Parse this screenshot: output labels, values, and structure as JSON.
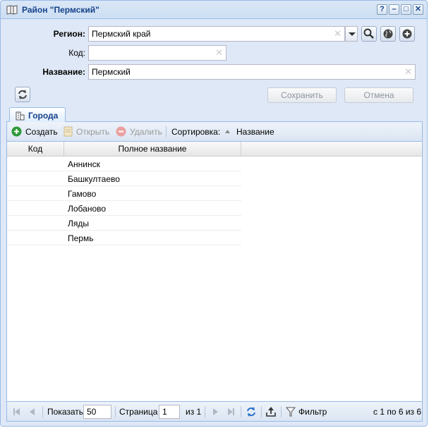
{
  "window": {
    "title": "Район \"Пермский\"",
    "tools": [
      "?",
      "–",
      "□",
      "✕"
    ]
  },
  "form": {
    "region_label": "Регион:",
    "region_value": "Пермский край",
    "code_label": "Код:",
    "code_value": "",
    "name_label": "Название:",
    "name_value": "Пермский",
    "save_label": "Сохранить",
    "cancel_label": "Отмена"
  },
  "tabs": [
    {
      "label": "Города"
    }
  ],
  "toolbar": {
    "create_label": "Создать",
    "open_label": "Открыть",
    "delete_label": "Удалить",
    "sort_label": "Сортировка:",
    "sort_field": "Название"
  },
  "grid": {
    "columns": [
      "Код",
      "Полное название"
    ],
    "rows": [
      {
        "code": "",
        "name": "Аннинск"
      },
      {
        "code": "",
        "name": "Башкултаево"
      },
      {
        "code": "",
        "name": "Гамово"
      },
      {
        "code": "",
        "name": "Лобаново"
      },
      {
        "code": "",
        "name": "Ляды"
      },
      {
        "code": "",
        "name": "Пермь"
      }
    ]
  },
  "pager": {
    "show_label": "Показать",
    "page_size": "50",
    "page_label": "Страница",
    "page_value": "1",
    "of_label": "из 1",
    "filter_label": "Фильтр",
    "summary": "с 1 по 6 из 6"
  },
  "colors": {
    "accent": "#15428b",
    "border": "#99bbe8",
    "background": "#dfe8f6",
    "create_icon": "#2e9a3a",
    "delete_icon": "#e06060"
  }
}
